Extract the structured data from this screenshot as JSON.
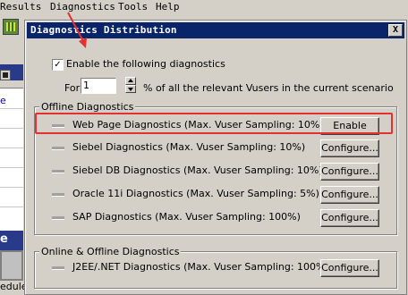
{
  "app": {
    "menu": [
      "Results",
      "Diagnostics",
      "Tools",
      "Help"
    ],
    "left_link": "e",
    "left_heading": "e",
    "left_bottom": "edule"
  },
  "dialog": {
    "title": "Diagnostics Distribution",
    "close_label": "X",
    "enable_checkbox_label": "Enable the following diagnostics",
    "enable_checked": true,
    "for_label": "For",
    "percent_value": "1",
    "percent_suffix": "% of all the relevant Vusers in the current scenario",
    "offline_group_title": "Offline Diagnostics",
    "offline_items": [
      {
        "label": "Web Page Diagnostics  (Max. Vuser Sampling: 10%)",
        "button": "Enable"
      },
      {
        "label": "Siebel Diagnostics  (Max. Vuser Sampling: 10%)",
        "button": "Configure..."
      },
      {
        "label": "Siebel DB Diagnostics  (Max. Vuser Sampling: 10%)",
        "button": "Configure..."
      },
      {
        "label": "Oracle 11i Diagnostics  (Max. Vuser Sampling: 5%)",
        "button": "Configure..."
      },
      {
        "label": "SAP Diagnostics  (Max. Vuser Sampling: 100%)",
        "button": "Configure..."
      }
    ],
    "online_group_title": "Online & Offline Diagnostics",
    "online_items": [
      {
        "label": "J2EE/.NET Diagnostics  (Max. Vuser Sampling: 100%)",
        "button": "Configure..."
      }
    ]
  },
  "colors": {
    "titlebar": "#0a246a",
    "highlight": "#e53030",
    "annotation_arrow": "#e53030"
  }
}
